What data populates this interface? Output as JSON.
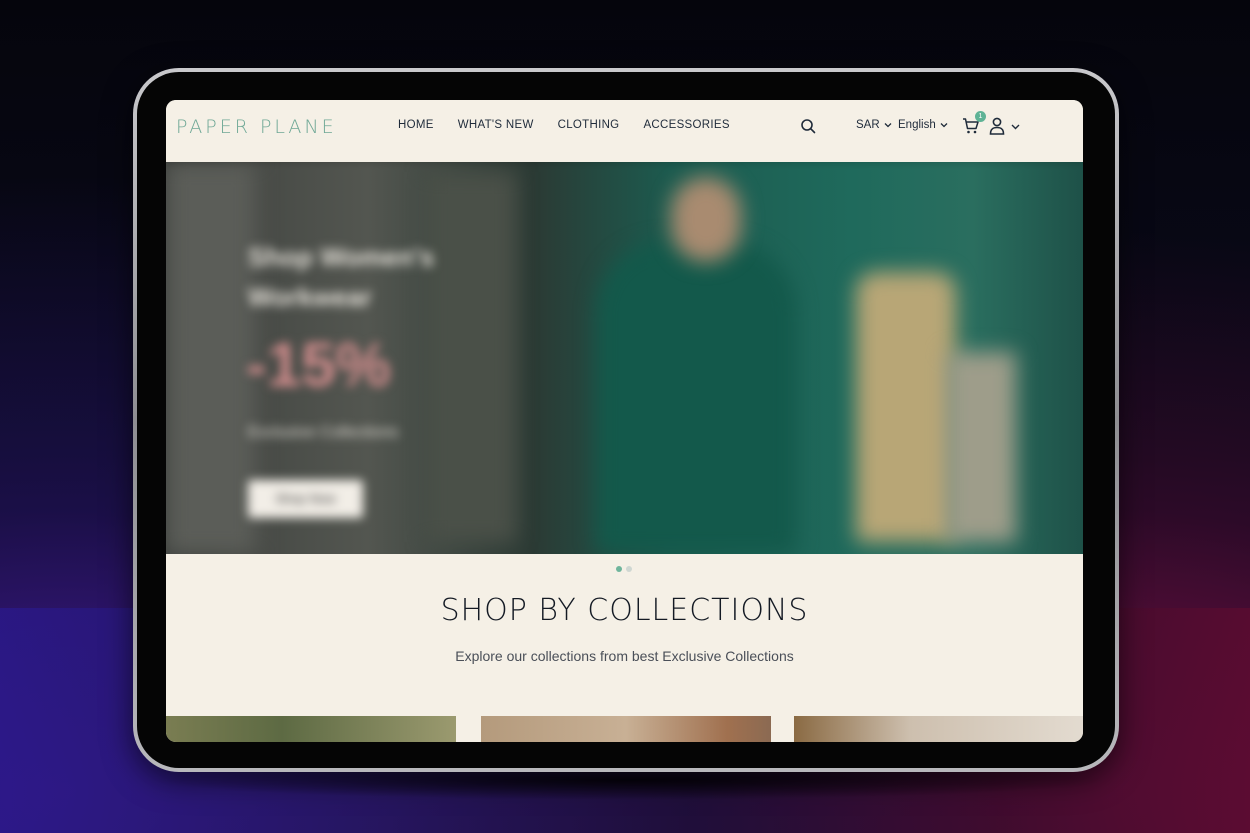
{
  "brand": {
    "logo_text": "PAPER PLANE",
    "primary_color": "#6fa896",
    "accent_color": "#d49a9a"
  },
  "nav": {
    "items": [
      {
        "label": "HOME"
      },
      {
        "label": "WHAT'S NEW"
      },
      {
        "label": "CLOTHING"
      },
      {
        "label": "ACCESSORIES"
      }
    ]
  },
  "header": {
    "currency": "SAR",
    "language": "English",
    "cart_count": "1",
    "icons": [
      "search-icon",
      "cart-icon",
      "user-icon",
      "chevron-down-icon"
    ]
  },
  "hero": {
    "headline_line1": "Shop Women's",
    "headline_line2": "Workwear",
    "discount": "-15%",
    "subline": "Exclusive Collections",
    "cta_label": "Shop Now",
    "slide_count": 2,
    "active_slide": 1
  },
  "collections": {
    "title": "SHOP BY COLLECTIONS",
    "subtitle": "Explore our collections from best Exclusive Collections"
  }
}
